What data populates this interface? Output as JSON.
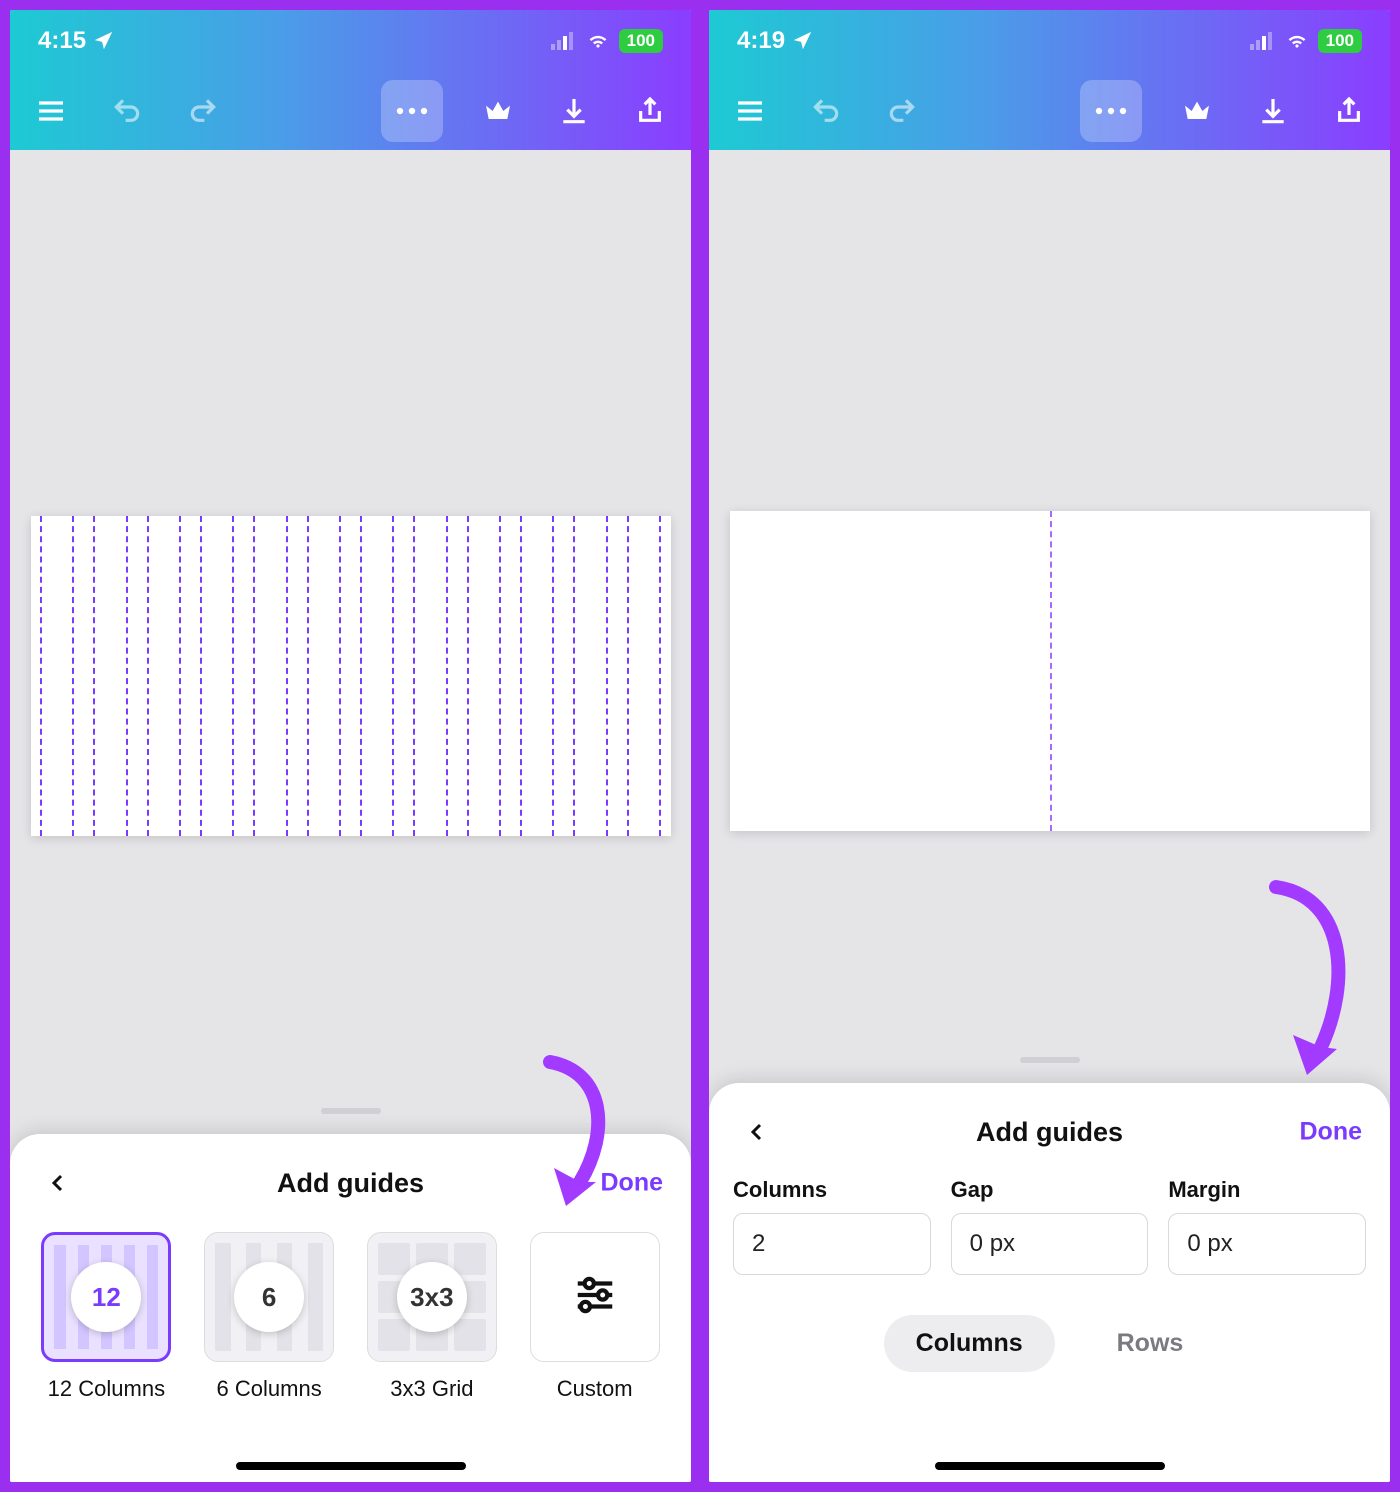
{
  "left_screen": {
    "status": {
      "time": "4:15",
      "battery": "100"
    },
    "sheet": {
      "title": "Add guides",
      "done": "Done",
      "options": [
        {
          "badge": "12",
          "label": "12 Columns"
        },
        {
          "badge": "6",
          "label": "6 Columns"
        },
        {
          "badge": "3x3",
          "label": "3x3 Grid"
        },
        {
          "badge": "",
          "label": "Custom"
        }
      ]
    },
    "canvas": {
      "columns": 12
    }
  },
  "right_screen": {
    "status": {
      "time": "4:19",
      "battery": "100"
    },
    "sheet": {
      "title": "Add guides",
      "done": "Done",
      "fields": {
        "columns_label": "Columns",
        "gap_label": "Gap",
        "margin_label": "Margin",
        "columns_value": "2",
        "gap_value": "0 px",
        "margin_value": "0 px"
      },
      "segment": {
        "columns": "Columns",
        "rows": "Rows"
      }
    }
  },
  "colors": {
    "accent": "#7a3bff",
    "annotation": "#a23bff"
  }
}
